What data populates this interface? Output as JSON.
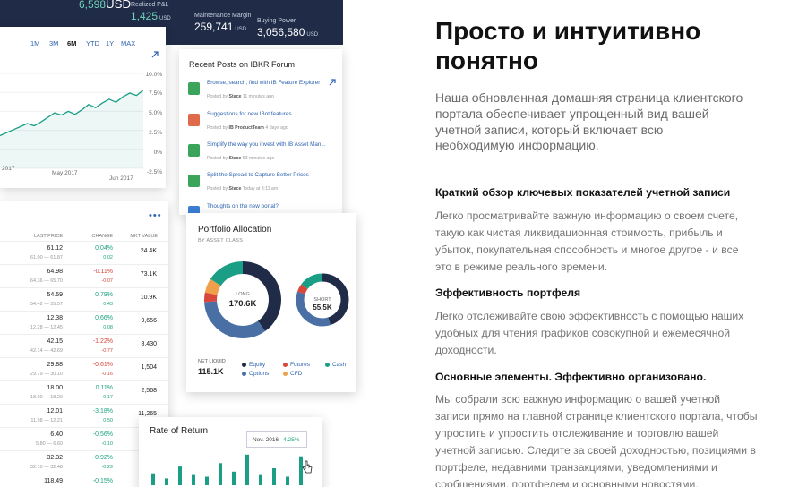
{
  "topbar": {
    "items": [
      {
        "label": "",
        "value": "6,598",
        "unit": "USD",
        "accent": true
      },
      {
        "label": "Realized P&L",
        "value": "1,425",
        "unit": "USD",
        "accent": true
      },
      {
        "label": "Maintenance Margin",
        "value": "259,741",
        "unit": "USD",
        "accent": false
      },
      {
        "label": "Buying Power",
        "value": "3,056,580",
        "unit": "USD",
        "accent": false
      }
    ]
  },
  "portfolio_chart": {
    "ranges": [
      "1M",
      "3M",
      "6M",
      "YTD",
      "1Y",
      "MAX"
    ],
    "active_range": "6M",
    "expand_icon": "arrow-expand-icon",
    "chart_data": {
      "type": "line",
      "x_labels": [
        "2017",
        "May 2017",
        "Jun 2017"
      ],
      "ytick_labels": [
        "10.0%",
        "7.5%",
        "5.0%",
        "2.5%",
        "0%",
        "-2.5%"
      ],
      "ylim": [
        -2.5,
        10
      ],
      "values": [
        1.8,
        2.2,
        2.6,
        3.0,
        3.4,
        3.1,
        3.6,
        4.2,
        4.8,
        4.5,
        5.0,
        4.6,
        5.2,
        5.9,
        5.5,
        6.1,
        6.6,
        6.2,
        6.9,
        7.4,
        7.1,
        7.8
      ]
    }
  },
  "forum": {
    "title": "Recent Posts on IBKR Forum",
    "expand_icon": "arrow-expand-icon",
    "posts": [
      {
        "title": "Browse, search, find with IB Feature Explorer",
        "posted_by": "Posted by",
        "author": "Stace",
        "time": "11 minutes ago",
        "color": "#3aa55a"
      },
      {
        "title": "Suggestions for new IBot features",
        "posted_by": "Posted by",
        "author": "IB ProductTeam",
        "time": "4 days ago",
        "color": "#e06b4a"
      },
      {
        "title": "Simplify the way you invest with IB Asset Man...",
        "posted_by": "Posted by",
        "author": "Stace",
        "time": "53 minutes ago",
        "color": "#3aa55a"
      },
      {
        "title": "Split the Spread to Capture Better Prices",
        "posted_by": "Posted by",
        "author": "Stace",
        "time": "Today at 8:11 am",
        "color": "#3aa55a"
      },
      {
        "title": "Thoughts on the new portal?",
        "posted_by": "",
        "author": "",
        "time": "",
        "color": "#3b7fd4"
      }
    ]
  },
  "positions": {
    "menu_icon": "more-dots-icon",
    "headers": {
      "price": "LAST PRICE",
      "change": "CHANGE",
      "mkt": "MKT VALUE"
    },
    "rows": [
      {
        "price": "61.12",
        "range": "61.00 — 61.87",
        "chg": "0.04%",
        "chg2": "0.02",
        "dir": "pos",
        "mkt": "24.4K"
      },
      {
        "price": "64.98",
        "range": "64.36 — 65.70",
        "chg": "-0.11%",
        "chg2": "-0.07",
        "dir": "neg",
        "mkt": "73.1K"
      },
      {
        "price": "54.59",
        "range": "54.42 — 55.57",
        "chg": "0.79%",
        "chg2": "0.43",
        "dir": "pos",
        "mkt": "10.9K"
      },
      {
        "price": "12.38",
        "range": "12.28 — 12.45",
        "chg": "0.66%",
        "chg2": "0.08",
        "dir": "pos",
        "mkt": "9,656"
      },
      {
        "price": "42.15",
        "range": "42.14 — 42.69",
        "chg": "-1.22%",
        "chg2": "-0.77",
        "dir": "neg",
        "mkt": "8,430"
      },
      {
        "price": "29.88",
        "range": "29.79 — 30.10",
        "chg": "-0.61%",
        "chg2": "-0.16",
        "dir": "neg",
        "mkt": "1,504"
      },
      {
        "price": "18.00",
        "range": "18.00 — 18.20",
        "chg": "0.11%",
        "chg2": "0.17",
        "dir": "pos",
        "mkt": "2,568"
      },
      {
        "price": "12.01",
        "range": "11.98 — 12.21",
        "chg": "-3.18%",
        "chg2": "0.50",
        "dir": "pos",
        "mkt": "11,265"
      },
      {
        "price": "6.40",
        "range": "5.80 — 6.60",
        "chg": "-0.56%",
        "chg2": "-0.10",
        "dir": "pos",
        "mkt": ""
      },
      {
        "price": "32.32",
        "range": "32.10 — 32.48",
        "chg": "-0.92%",
        "chg2": "-0.29",
        "dir": "pos",
        "mkt": ""
      },
      {
        "price": "118.49",
        "range": "118.17 — 118.75",
        "chg": "-0.15%",
        "chg2": "-0.20",
        "dir": "pos",
        "mkt": ""
      }
    ]
  },
  "allocation": {
    "title": "Portfolio Allocation",
    "subtitle": "BY ASSET CLASS",
    "long_label": "LONG",
    "long_value": "170.6K",
    "short_label": "SHORT",
    "short_value": "55.5K",
    "netliq_label": "NET LIQUID",
    "netliq_value": "115.1K",
    "legend": [
      {
        "label": "Equity",
        "color": "#1f2b47"
      },
      {
        "label": "Futures",
        "color": "#d8463c"
      },
      {
        "label": "Cash",
        "color": "#1a9f86"
      },
      {
        "label": "Options",
        "color": "#4a6fa5"
      },
      {
        "label": "CFD",
        "color": "#f0a04b"
      }
    ],
    "long_segments": [
      {
        "asset": "Equity",
        "fraction": 0.4,
        "color": "#1f2b47"
      },
      {
        "asset": "Options",
        "fraction": 0.34,
        "color": "#4a6fa5"
      },
      {
        "asset": "Futures",
        "fraction": 0.04,
        "color": "#d8463c"
      },
      {
        "asset": "CFD",
        "fraction": 0.06,
        "color": "#f0a04b"
      },
      {
        "asset": "Cash",
        "fraction": 0.16,
        "color": "#1a9f86"
      }
    ],
    "short_segments": [
      {
        "asset": "Equity",
        "fraction": 0.45,
        "color": "#1f2b47"
      },
      {
        "asset": "Options",
        "fraction": 0.35,
        "color": "#4a6fa5"
      },
      {
        "asset": "Futures",
        "fraction": 0.05,
        "color": "#d8463c"
      },
      {
        "asset": "Cash",
        "fraction": 0.15,
        "color": "#1a9f86"
      }
    ]
  },
  "rate_of_return": {
    "title": "Rate of Return",
    "tooltip_date": "Nov. 2016",
    "tooltip_value": "4.25%",
    "bar_values": [
      0.35,
      0.2,
      0.55,
      0.3,
      0.25,
      0.65,
      0.4,
      0.9,
      0.3,
      0.5,
      0.25,
      0.85
    ]
  },
  "content": {
    "headline": "Просто и интуитивно понятно",
    "intro": "Наша обновленная домашняя страница клиентского портала обеспечивает упрощенный вид вашей учетной записи, который включает всю необходимую информацию.",
    "sections": [
      {
        "title": "Краткий обзор ключевых показателей учетной записи",
        "body": "Легко просматривайте важную информацию о своем счете, такую как чистая ликвидационная стоимость, прибыль и убыток, покупательная способность и многое другое - и все это в режиме реального времени."
      },
      {
        "title": "Эффективность портфеля",
        "body": "Легко отслеживайте свою эффективность с помощью наших удобных для чтения графиков совокупной и ежемесячной доходности."
      },
      {
        "title": "Основные элементы. Эффективно организовано.",
        "body": "Мы собрали всю важную информацию о вашей учетной записи прямо на главной странице клиентского портала, чтобы упростить и упростить отслеживание и торговлю вашей учетной записью. Следите за своей доходностью, позициями в портфеле, недавними транзакциями, уведомлениями и сообщениями, портфелем и основными новостями, наличными"
      }
    ]
  }
}
